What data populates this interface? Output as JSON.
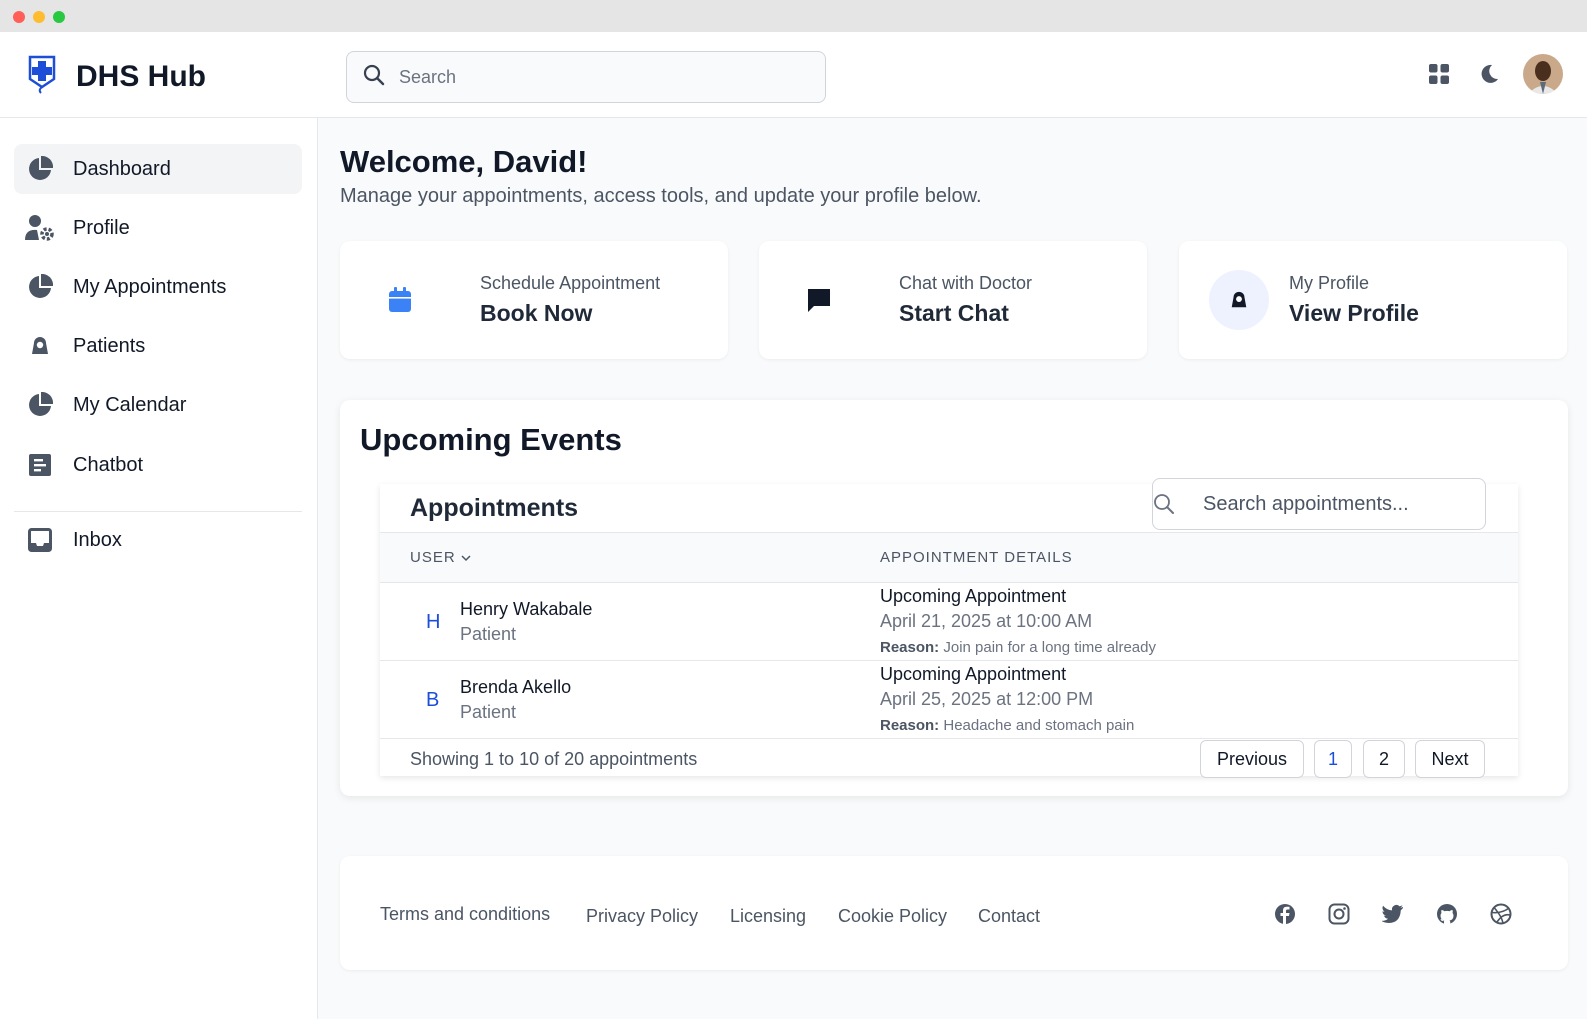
{
  "window": {
    "traffic_lights": [
      "close",
      "minimize",
      "zoom"
    ]
  },
  "app": {
    "title": "DHS Hub",
    "logo_icon": "medical-cross-icon",
    "accent": "#1d4ed8"
  },
  "header": {
    "search_placeholder": "Search",
    "icons": [
      "apps-grid-icon",
      "moon-icon",
      "user-avatar"
    ]
  },
  "sidebar": {
    "items": [
      {
        "label": "Dashboard",
        "icon": "pie-chart-icon",
        "active": true
      },
      {
        "label": "Profile",
        "icon": "user-gear-icon"
      },
      {
        "label": "My Appointments",
        "icon": "pie-chart-icon"
      },
      {
        "label": "Patients",
        "icon": "user-icon"
      },
      {
        "label": "My Calendar",
        "icon": "pie-chart-icon"
      },
      {
        "label": "Chatbot",
        "icon": "document-icon"
      }
    ],
    "secondary": [
      {
        "label": "Inbox",
        "icon": "inbox-icon"
      }
    ]
  },
  "main": {
    "welcome_title": "Welcome, David!",
    "welcome_subtitle": "Manage your appointments, access tools, and update your profile below.",
    "cards": [
      {
        "label": "Schedule Appointment",
        "action": "Book Now",
        "icon": "calendar-icon"
      },
      {
        "label": "Chat with Doctor",
        "action": "Start Chat",
        "icon": "chat-bubble-icon"
      },
      {
        "label": "My Profile",
        "action": "View Profile",
        "icon": "user-icon"
      }
    ]
  },
  "events": {
    "title": "Upcoming Events",
    "appointments": {
      "title": "Appointments",
      "search_placeholder": "Search appointments...",
      "columns": [
        "USER",
        "APPOINTMENT DETAILS"
      ],
      "rows": [
        {
          "initial": "H",
          "name": "Henry Wakabale",
          "role": "Patient",
          "title": "Upcoming Appointment",
          "date": "April 21, 2025 at 10:00 AM",
          "reason_label": "Reason:",
          "reason": "Join pain for a long time already"
        },
        {
          "initial": "B",
          "name": "Brenda Akello",
          "role": "Patient",
          "title": "Upcoming Appointment",
          "date": "April 25, 2025 at 12:00 PM",
          "reason_label": "Reason:",
          "reason": "Headache and stomach pain"
        }
      ],
      "showing": "Showing 1 to 10 of 20 appointments",
      "pagination": {
        "previous": "Previous",
        "pages": [
          "1",
          "2"
        ],
        "current": "1",
        "next": "Next"
      }
    }
  },
  "footer": {
    "links": [
      "Terms and conditions",
      "Privacy Policy",
      "Licensing",
      "Cookie Policy",
      "Contact"
    ],
    "social": [
      "facebook-icon",
      "instagram-icon",
      "twitter-icon",
      "github-icon",
      "dribbble-icon"
    ]
  }
}
